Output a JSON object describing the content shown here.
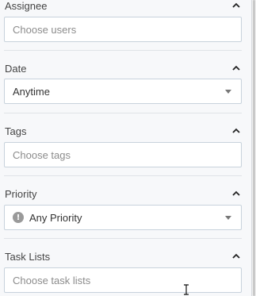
{
  "sections": {
    "assignee": {
      "title": "Assignee",
      "placeholder": "Choose users"
    },
    "date": {
      "title": "Date",
      "value": "Anytime"
    },
    "tags": {
      "title": "Tags",
      "placeholder": "Choose tags"
    },
    "priority": {
      "title": "Priority",
      "value": "Any Priority",
      "icon": "exclamation-circle-icon"
    },
    "task_lists": {
      "title": "Task Lists",
      "placeholder": "Choose task lists"
    }
  },
  "icons": {
    "collapse": "chevron-up-icon",
    "dropdown": "caret-down-icon",
    "cursor": "text-cursor-icon"
  },
  "colors": {
    "panel_bg": "#f7f8fa",
    "field_border": "#c8d2dc",
    "priority_icon": "#9a9a9a"
  }
}
